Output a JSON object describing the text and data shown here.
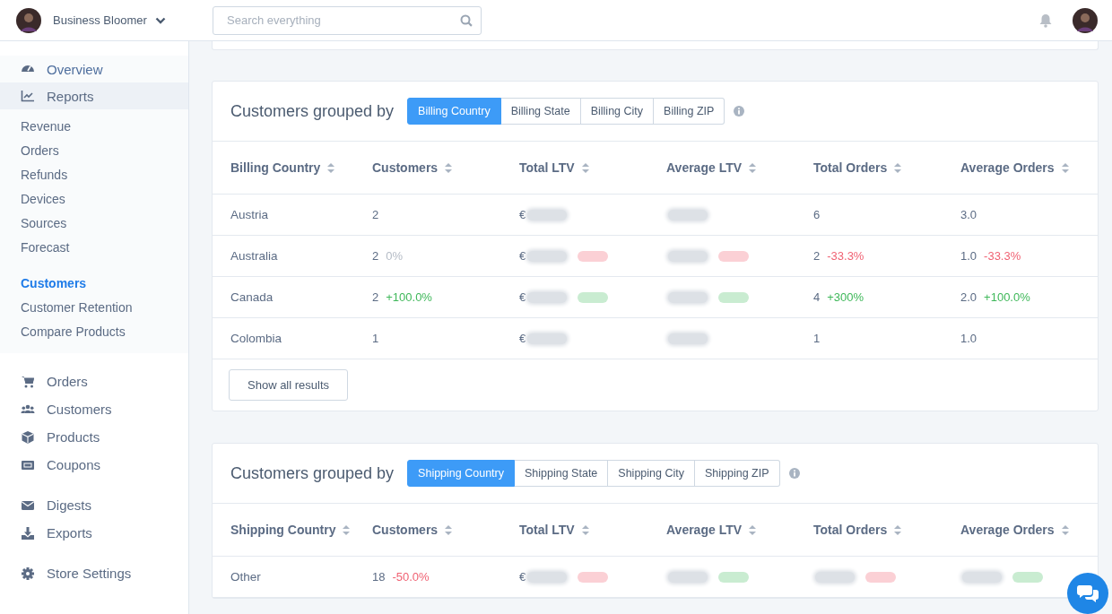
{
  "topbar": {
    "store_name": "Business Bloomer",
    "search": {
      "placeholder": "Search everything"
    }
  },
  "sidebar": {
    "primary": [
      {
        "label": "Overview",
        "selected": false
      },
      {
        "label": "Reports",
        "selected": true,
        "subgroups": [
          [
            {
              "label": "Revenue",
              "selected": false
            },
            {
              "label": "Orders",
              "selected": false
            },
            {
              "label": "Refunds",
              "selected": false
            },
            {
              "label": "Devices",
              "selected": false
            },
            {
              "label": "Sources",
              "selected": false
            },
            {
              "label": "Forecast",
              "selected": false
            }
          ],
          [
            {
              "label": "Customers",
              "selected": true
            },
            {
              "label": "Customer Retention",
              "selected": false
            },
            {
              "label": "Compare Products",
              "selected": false
            }
          ]
        ]
      }
    ],
    "groups": [
      [
        {
          "label": "Orders"
        },
        {
          "label": "Customers"
        },
        {
          "label": "Products"
        },
        {
          "label": "Coupons"
        }
      ],
      [
        {
          "label": "Digests"
        },
        {
          "label": "Exports"
        }
      ],
      [
        {
          "label": "Store Settings"
        }
      ]
    ]
  },
  "sections": [
    {
      "title": "Customers grouped by",
      "tabs": [
        {
          "label": "Billing Country",
          "selected": true
        },
        {
          "label": "Billing State",
          "selected": false
        },
        {
          "label": "Billing City",
          "selected": false
        },
        {
          "label": "Billing ZIP",
          "selected": false
        }
      ],
      "columns": [
        "Billing Country",
        "Customers",
        "Total LTV",
        "Average LTV",
        "Total Orders",
        "Average Orders"
      ],
      "rows": [
        {
          "cells": [
            {
              "text": "Austria"
            },
            {
              "text": "2"
            },
            {
              "text": "€",
              "blurred": true
            },
            {
              "blurred": true
            },
            {
              "text": "6"
            },
            {
              "text": "3.0"
            }
          ]
        },
        {
          "cells": [
            {
              "text": "Australia"
            },
            {
              "text": "2",
              "change": "0%",
              "color": "#b5bcc6"
            },
            {
              "text": "€",
              "blurred": true,
              "color": "#fbd0d5"
            },
            {
              "blurred": true,
              "color": "#fbd0d5"
            },
            {
              "text": "2",
              "change": "-33.3%",
              "color": "#f06273"
            },
            {
              "text": "1.0",
              "change": "-33.3%",
              "color": "#f06273"
            }
          ]
        },
        {
          "cells": [
            {
              "text": "Canada"
            },
            {
              "text": "2",
              "change": "+100.0%",
              "color": "#3fb85a"
            },
            {
              "text": "€",
              "blurred": true,
              "color": "#c9ecd1"
            },
            {
              "blurred": true,
              "color": "#c9ecd1"
            },
            {
              "text": "4",
              "change": "+300%",
              "color": "#3fb85a"
            },
            {
              "text": "2.0",
              "change": "+100.0%",
              "color": "#3fb85a"
            }
          ]
        },
        {
          "cells": [
            {
              "text": "Colombia"
            },
            {
              "text": "1"
            },
            {
              "text": "€",
              "blurred": true
            },
            {
              "blurred": true
            },
            {
              "text": "1"
            },
            {
              "text": "1.0"
            }
          ]
        }
      ],
      "button": "Show all results"
    },
    {
      "title": "Customers grouped by",
      "tabs": [
        {
          "label": "Shipping Country",
          "selected": true
        },
        {
          "label": "Shipping State",
          "selected": false
        },
        {
          "label": "Shipping City",
          "selected": false
        },
        {
          "label": "Shipping ZIP",
          "selected": false
        }
      ],
      "columns": [
        "Shipping Country",
        "Customers",
        "Total LTV",
        "Average LTV",
        "Total Orders",
        "Average Orders"
      ],
      "rows": [
        {
          "cells": [
            {
              "text": "Other"
            },
            {
              "text": "18",
              "change": "-50.0%",
              "color": "#f06273"
            },
            {
              "text": "€",
              "blurred": true,
              "color": "#fbd0d5"
            },
            {
              "blurred": true,
              "color": "#c9ecd1"
            },
            {
              "blurred": true,
              "color": "#fbd0d5"
            },
            {
              "blurred": true,
              "color": "#c9ecd1"
            }
          ]
        }
      ]
    }
  ]
}
